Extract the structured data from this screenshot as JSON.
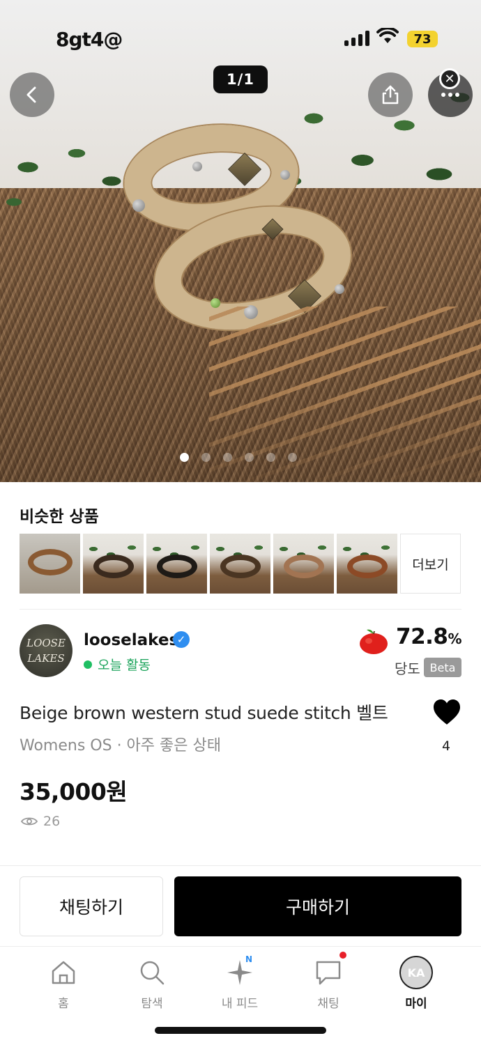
{
  "status_bar": {
    "time": "8gt4@",
    "battery": "73"
  },
  "photo": {
    "counter": "1/1",
    "description_colors": {
      "belt": "#cdb58e",
      "stitch": "#a8875c",
      "fur": "#6e5037"
    }
  },
  "similar": {
    "title": "비슷한 상품",
    "more_label": "더보기",
    "thumb_count": 6
  },
  "seller": {
    "avatar_text_line1": "LOOSE",
    "avatar_text_line2": "LAKES",
    "name": "looselakes",
    "verified_icon": "verified-badge-icon",
    "activity": "오늘 활동",
    "score_value": "72.8",
    "score_unit": "%",
    "score_label": "당도",
    "beta_label": "Beta"
  },
  "product": {
    "title": "Beige brown western stud suede stitch 벨트",
    "meta": "Womens OS · 아주 좋은 상태",
    "likes": "4",
    "price": "35,000원",
    "views": "26"
  },
  "actions": {
    "chat_label": "채팅하기",
    "buy_label": "구매하기"
  },
  "tabbar": {
    "items": [
      {
        "label": "홈",
        "icon": "home-icon"
      },
      {
        "label": "탐색",
        "icon": "search-icon"
      },
      {
        "label": "내 피드",
        "icon": "sparkle-icon",
        "badge": "N"
      },
      {
        "label": "채팅",
        "icon": "chat-bubble-icon"
      },
      {
        "label": "마이",
        "icon": "avatar",
        "avatar_text": "KA"
      }
    ]
  },
  "colors": {
    "accent_green": "#1fbf63",
    "verified_blue": "#2f8ef0",
    "notification_red": "#e8202a",
    "battery_yellow": "#f3d22f"
  }
}
